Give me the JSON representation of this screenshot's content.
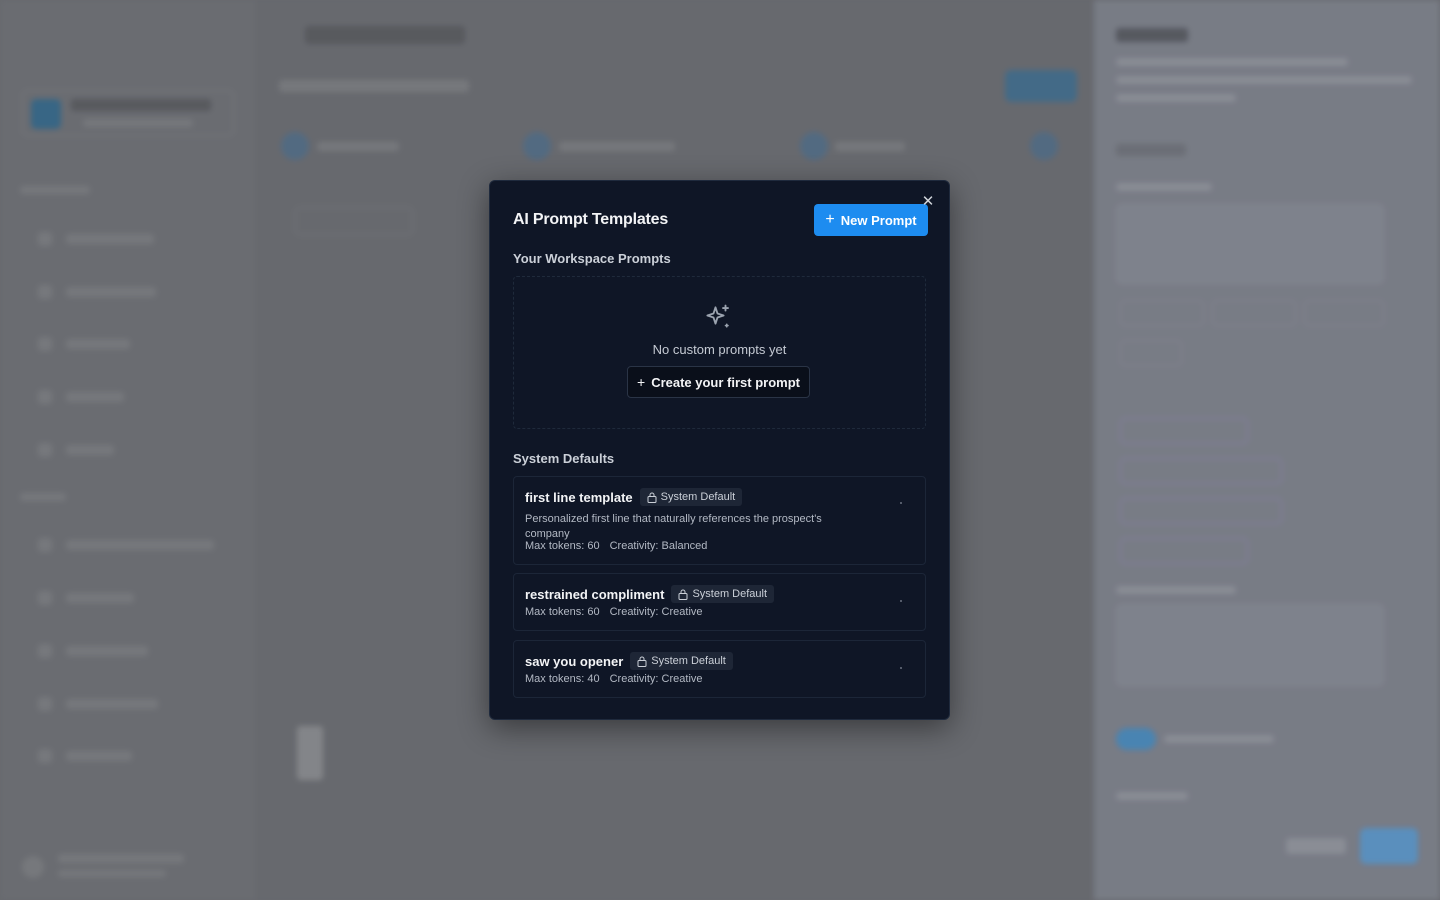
{
  "modal": {
    "title": "AI Prompt Templates",
    "new_button_label": "New Prompt",
    "close_symbol": "✕",
    "workspace_section_label": "Your Workspace Prompts",
    "empty_state_text": "No custom prompts yet",
    "create_first_label": "Create your first prompt",
    "system_section_label": "System Defaults",
    "templates": [
      {
        "name": "first line template",
        "badge": "System Default",
        "description": "Personalized first line that naturally references the prospect's company",
        "max_tokens": "Max tokens: 60",
        "creativity": "Creativity: Balanced"
      },
      {
        "name": "restrained compliment",
        "badge": "System Default",
        "description": "",
        "max_tokens": "Max tokens: 60",
        "creativity": "Creativity: Creative"
      },
      {
        "name": "saw you opener",
        "badge": "System Default",
        "description": "",
        "max_tokens": "Max tokens: 40",
        "creativity": "Creativity: Creative"
      }
    ]
  },
  "colors": {
    "accent": "#1d8cf0",
    "modal_bg": "#0f1626",
    "backdrop": "#6b6d72"
  },
  "icons": {
    "sparkle": "sparkles-icon",
    "lock": "lock-icon",
    "plus": "plus-icon",
    "close": "close-icon"
  }
}
